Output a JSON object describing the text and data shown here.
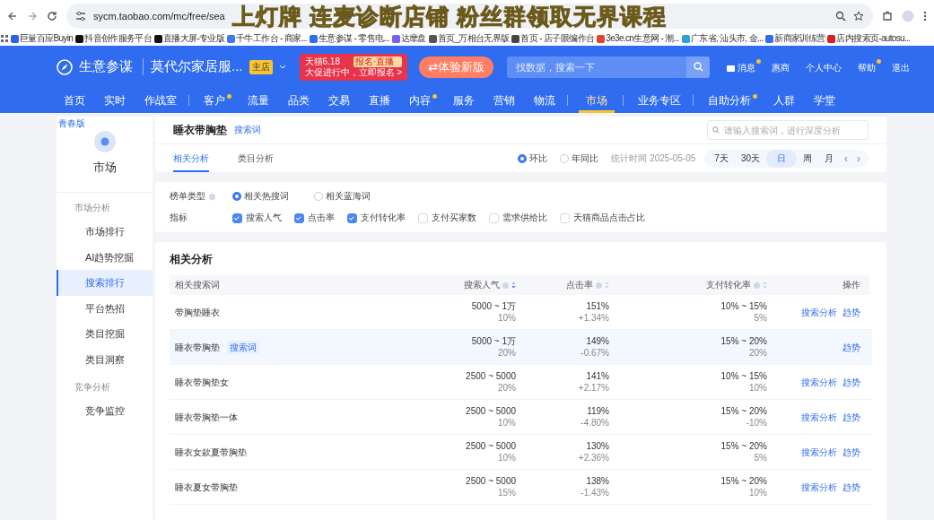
{
  "browser": {
    "url": "sycm.taobao.com/mc/free/sea",
    "caption": "上灯牌 连麦诊断店铺 粉丝群领取无界课程",
    "bookmarks": [
      {
        "label": "巨量百应Buyin",
        "color": "#2b64e8"
      },
      {
        "label": "抖音创作服务平台",
        "color": "#111111"
      },
      {
        "label": "直播大屏-专业版",
        "color": "#111111"
      },
      {
        "label": "千牛工作台 - 商家...",
        "color": "#3b7bf6"
      },
      {
        "label": "生意参谋 - 零售电...",
        "color": "#2f6ef2"
      },
      {
        "label": "达摩盘",
        "color": "#7a5cf0"
      },
      {
        "label": "首页_万相台无界版",
        "color": "#555555"
      },
      {
        "label": "首页 - 店子眼编作台",
        "color": "#444444"
      },
      {
        "label": "3e3e.cn生意网 - 潮...",
        "color": "#e0452b"
      },
      {
        "label": "广东省, 汕头市, 金...",
        "color": "#2aa3d8"
      },
      {
        "label": "新商家训练营",
        "color": "#2f6ef2"
      },
      {
        "label": "店内搜索页-autosu...",
        "color": "#d82020"
      }
    ]
  },
  "header": {
    "app_name": "生意参谋",
    "shop_name": "莫代尔家居服...",
    "shop_badge": "主店",
    "promo": {
      "title": "天猫6.18",
      "tag": "报名·直播",
      "subtitle": "大促进行中，立即报名 >"
    },
    "new_version_button": "⇄体验新版",
    "search": {
      "placeholder": "找数据，搜索一下"
    },
    "links": [
      {
        "label": "消息",
        "dot": true,
        "kind": "mail"
      },
      {
        "label": "惠商",
        "dot": false,
        "kind": "plain"
      },
      {
        "label": "个人中心",
        "dot": false,
        "kind": "plain"
      },
      {
        "label": "帮助",
        "dot": true,
        "kind": "plain"
      },
      {
        "label": "退出",
        "dot": false,
        "kind": "plain"
      }
    ]
  },
  "nav": [
    {
      "kind": "link",
      "label": "首页",
      "dot": false,
      "selected": false
    },
    {
      "kind": "link",
      "label": "实时",
      "dot": false,
      "selected": false
    },
    {
      "kind": "link",
      "label": "作战室",
      "dot": false,
      "selected": false
    },
    {
      "kind": "separator"
    },
    {
      "kind": "link",
      "label": "客户",
      "dot": true,
      "selected": false
    },
    {
      "kind": "link",
      "label": "流量",
      "dot": false,
      "selected": false
    },
    {
      "kind": "link",
      "label": "品类",
      "dot": false,
      "selected": false
    },
    {
      "kind": "link",
      "label": "交易",
      "dot": false,
      "selected": false
    },
    {
      "kind": "link",
      "label": "直播",
      "dot": false,
      "selected": false
    },
    {
      "kind": "link",
      "label": "内容",
      "dot": true,
      "selected": false
    },
    {
      "kind": "link",
      "label": "服务",
      "dot": false,
      "selected": false
    },
    {
      "kind": "link",
      "label": "营销",
      "dot": false,
      "selected": false
    },
    {
      "kind": "link",
      "label": "物流",
      "dot": false,
      "selected": false
    },
    {
      "kind": "separator"
    },
    {
      "kind": "link",
      "label": "市场",
      "dot": false,
      "selected": true
    },
    {
      "kind": "separator"
    },
    {
      "kind": "link",
      "label": "业务专区",
      "dot": false,
      "selected": false
    },
    {
      "kind": "separator"
    },
    {
      "kind": "link",
      "label": "自助分析",
      "dot": true,
      "selected": false
    },
    {
      "kind": "link",
      "label": "人群",
      "dot": false,
      "selected": false
    },
    {
      "kind": "link",
      "label": "学堂",
      "dot": false,
      "selected": false
    }
  ],
  "sidebar": {
    "edition": "青春版",
    "title": "市场",
    "items": [
      {
        "kind": "group",
        "label": "市场分析"
      },
      {
        "kind": "item",
        "label": "市场排行",
        "selected": false
      },
      {
        "kind": "item",
        "label": "AI趋势挖掘",
        "selected": false
      },
      {
        "kind": "item",
        "label": "搜索排行",
        "selected": true
      },
      {
        "kind": "item",
        "label": "平台热招",
        "selected": false
      },
      {
        "kind": "item",
        "label": "类目挖掘",
        "selected": false
      },
      {
        "kind": "item",
        "label": "类目洞察",
        "selected": false
      },
      {
        "kind": "group",
        "label": "竞争分析"
      },
      {
        "kind": "item",
        "label": "竞争监控",
        "selected": false
      }
    ]
  },
  "keyword_header": {
    "title": "睡衣带胸垫",
    "tag": "搜索词",
    "search": {
      "placeholder": "请输入搜索词，进行深度分析"
    },
    "tabs": [
      {
        "label": "相关分析",
        "selected": true
      },
      {
        "label": "类目分析",
        "selected": false
      }
    ],
    "compare": [
      {
        "label": "环比",
        "selected": true
      },
      {
        "label": "年同比",
        "selected": false
      }
    ],
    "stat_time": "统计时间 2025-05-05",
    "periods": [
      {
        "label": "7天",
        "selected": false
      },
      {
        "label": "30天",
        "selected": false
      },
      {
        "label": "日",
        "selected": true
      },
      {
        "label": "周",
        "selected": false
      },
      {
        "label": "月",
        "selected": false
      }
    ],
    "prev": "‹",
    "next": "›"
  },
  "filters": {
    "list_type_label": "榜单类型",
    "list_types": [
      {
        "label": "相关热搜词",
        "selected": true
      },
      {
        "label": "相关蓝海词",
        "selected": false
      }
    ],
    "metrics_label": "指标",
    "metrics": [
      {
        "label": "搜索人气",
        "checked": true
      },
      {
        "label": "点击率",
        "checked": true
      },
      {
        "label": "支付转化率",
        "checked": true
      },
      {
        "label": "支付买家数",
        "checked": false
      },
      {
        "label": "需求供给比",
        "checked": false
      },
      {
        "label": "天猫商品点击占比",
        "checked": false
      }
    ]
  },
  "table": {
    "title": "相关分析",
    "columns": [
      {
        "label": "相关搜索词",
        "kind": "text"
      },
      {
        "label": "搜索人气",
        "kind": "sort"
      },
      {
        "label": "点击率",
        "kind": "sort"
      },
      {
        "label": "支付转化率",
        "kind": "sort"
      },
      {
        "label": "操作",
        "kind": "text"
      }
    ],
    "rows": [
      {
        "keyword": "带胸垫睡衣",
        "highlighted": false,
        "popularity": "5000 ~ 1万",
        "popularity_change": "10%",
        "ctr": "151%",
        "ctr_change": "+1.34%",
        "conversion": "10% ~ 15%",
        "conversion_change": "5%",
        "actions": [
          "搜索分析",
          "趋势"
        ]
      },
      {
        "keyword": "睡衣带胸垫",
        "tag": "搜索词",
        "highlighted": true,
        "popularity": "5000 ~ 1万",
        "popularity_change": "20%",
        "ctr": "149%",
        "ctr_change": "-0.67%",
        "conversion": "15% ~ 20%",
        "conversion_change": "20%",
        "actions": [
          "趋势"
        ]
      },
      {
        "keyword": "睡衣带胸垫女",
        "highlighted": false,
        "popularity": "2500 ~ 5000",
        "popularity_change": "20%",
        "ctr": "141%",
        "ctr_change": "+2.17%",
        "conversion": "10% ~ 15%",
        "conversion_change": "10%",
        "actions": [
          "搜索分析",
          "趋势"
        ]
      },
      {
        "keyword": "睡衣带胸垫一体",
        "highlighted": false,
        "popularity": "2500 ~ 5000",
        "popularity_change": "10%",
        "ctr": "119%",
        "ctr_change": "-4.80%",
        "conversion": "15% ~ 20%",
        "conversion_change": "-10%",
        "actions": [
          "搜索分析",
          "趋势"
        ]
      },
      {
        "keyword": "睡衣女款夏带胸垫",
        "highlighted": false,
        "popularity": "2500 ~ 5000",
        "popularity_change": "10%",
        "ctr": "130%",
        "ctr_change": "+2.36%",
        "conversion": "15% ~ 20%",
        "conversion_change": "5%",
        "actions": [
          "搜索分析",
          "趋势"
        ]
      },
      {
        "keyword": "睡衣夏女带胸垫",
        "highlighted": false,
        "popularity": "2500 ~ 5000",
        "popularity_change": "15%",
        "ctr": "138%",
        "ctr_change": "-1.43%",
        "conversion": "15% ~ 20%",
        "conversion_change": "10%",
        "actions": [
          "搜索分析",
          "趋势"
        ]
      }
    ]
  }
}
